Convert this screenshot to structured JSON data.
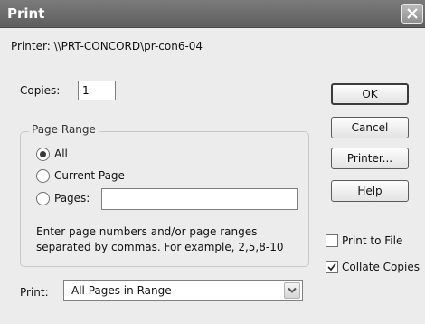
{
  "window": {
    "title": "Print"
  },
  "printer": {
    "line": "Printer:  \\\\PRT-CONCORD\\pr-con6-04"
  },
  "copies": {
    "label": "Copies:",
    "value": "1"
  },
  "page_range": {
    "legend": "Page Range",
    "options": [
      {
        "label": "All",
        "selected": true
      },
      {
        "label": "Current Page",
        "selected": false
      },
      {
        "label": "Pages:",
        "selected": false
      }
    ],
    "pages_value": "",
    "hint_line1": "Enter page numbers and/or page ranges",
    "hint_line2": "separated by commas. For example, 2,5,8-10"
  },
  "print_select": {
    "label": "Print:",
    "value": "All Pages in Range"
  },
  "buttons": {
    "ok": "OK",
    "cancel": "Cancel",
    "printer": "Printer...",
    "help": "Help"
  },
  "checks": [
    {
      "label": "Print to File",
      "checked": false
    },
    {
      "label": "Collate Copies",
      "checked": true
    }
  ]
}
